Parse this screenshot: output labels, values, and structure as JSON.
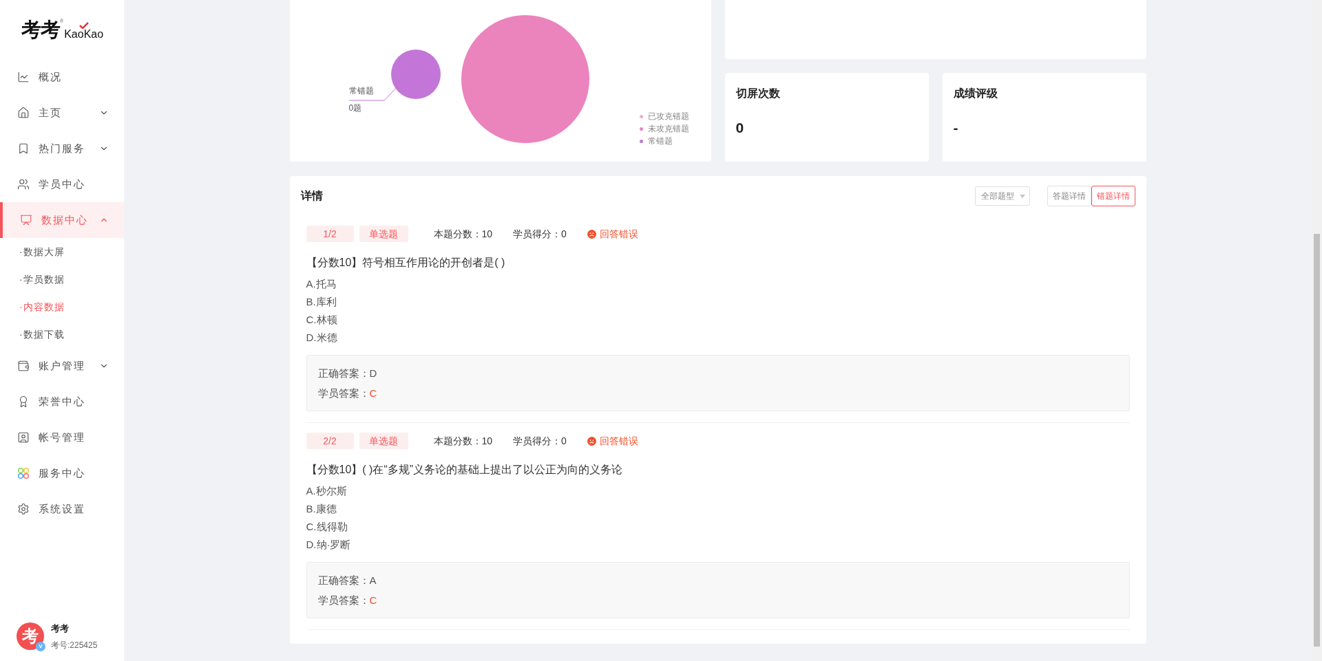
{
  "logo": {
    "cn": "考考",
    "mark": "®",
    "en": "KaoKao"
  },
  "sidebar": {
    "items": [
      {
        "label": "概况",
        "expandable": false,
        "selected": false
      },
      {
        "label": "主页",
        "expandable": true,
        "expanded": false,
        "selected": false
      },
      {
        "label": "热门服务",
        "expandable": true,
        "expanded": false,
        "selected": false
      },
      {
        "label": "学员中心",
        "expandable": false,
        "selected": false
      },
      {
        "label": "数据中心",
        "expandable": true,
        "expanded": true,
        "selected": true,
        "children": [
          {
            "label": "·数据大屏",
            "selected": false
          },
          {
            "label": "·学员数据",
            "selected": false
          },
          {
            "label": "·内容数据",
            "selected": true
          },
          {
            "label": "·数据下载",
            "selected": false
          }
        ]
      },
      {
        "label": "账户管理",
        "expandable": true,
        "expanded": false,
        "selected": false
      },
      {
        "label": "荣誉中心",
        "expandable": false,
        "selected": false
      },
      {
        "label": "帐号管理",
        "expandable": false,
        "selected": false
      },
      {
        "label": "服务中心",
        "expandable": false,
        "selected": false
      },
      {
        "label": "系统设置",
        "expandable": false,
        "selected": false
      }
    ]
  },
  "user": {
    "avatar_text": "考",
    "badge": "V",
    "name": "考考",
    "id": "考号:225425"
  },
  "bubble_chart": {
    "label": "常错题",
    "label_value": "0题",
    "legend": [
      {
        "label": "已攻克错题",
        "color": "#f4a8d1"
      },
      {
        "label": "未攻克错题",
        "color": "#eb83bd"
      },
      {
        "label": "常错题",
        "color": "#c376d8"
      }
    ]
  },
  "stats": [
    {
      "title": "切屏次数",
      "value": "0"
    },
    {
      "title": "成绩评级",
      "value": "-"
    }
  ],
  "details": {
    "title": "详情",
    "filter": "全部题型",
    "tabs": [
      {
        "label": "答题详情",
        "selected": false
      },
      {
        "label": "错题详情",
        "selected": true
      }
    ],
    "questions": [
      {
        "index": "1/2",
        "type": "单选题",
        "score": "本题分数：10",
        "student_score": "学员得分：0",
        "status": "回答错误",
        "correct": false,
        "text": "【分数10】符号相互作用论的开创者是( )",
        "options": [
          "A.托马",
          "B.库利",
          "C.林顿",
          "D.米德"
        ],
        "correct_answer_label": "正确答案：",
        "correct_answer": "D",
        "student_answer_label": "学员答案：",
        "student_answer": "C"
      },
      {
        "index": "2/2",
        "type": "单选题",
        "score": "本题分数：10",
        "student_score": "学员得分：0",
        "status": "回答错误",
        "correct": false,
        "text": "【分数10】( )在“多规”义务论的基础上提出了以公正为向的义务论",
        "options": [
          "A.秒尔斯",
          "B.康德",
          "C.线得勒",
          "D.纳·罗断"
        ],
        "correct_answer_label": "正确答案：",
        "correct_answer": "A",
        "student_answer_label": "学员答案：",
        "student_answer": "C"
      }
    ]
  }
}
